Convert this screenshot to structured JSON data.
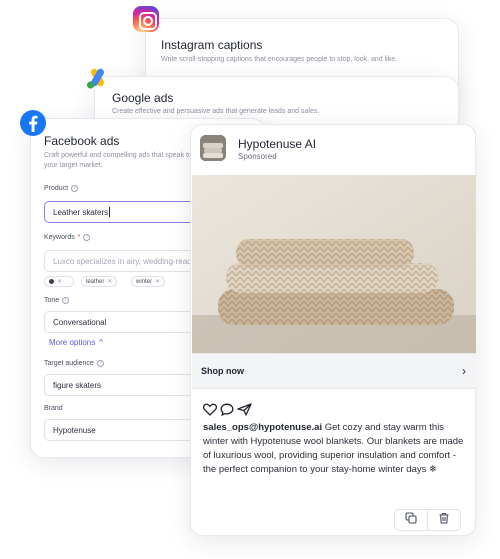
{
  "tools": {
    "instagram": {
      "title": "Instagram captions",
      "description": "Write scroll-stopping captions that encourages people to stop, look, and like."
    },
    "google": {
      "title": "Google ads",
      "description": "Create effective and persuasive ads that generate leads and sales."
    },
    "facebook": {
      "title": "Facebook ads",
      "description": "Craft powerful and compelling ads that speak to your target market."
    }
  },
  "form": {
    "product": {
      "label": "Product",
      "value": "Leather skaters"
    },
    "keywords": {
      "label": "Keywords",
      "required_mark": "*",
      "placeholder": "Luxco specializes in airy, wedding-ready",
      "chips": [
        "leather",
        "winter"
      ]
    },
    "tone": {
      "label": "Tone",
      "value": "Conversational"
    },
    "more_options": {
      "label": "More options",
      "chevron": "^"
    },
    "target_audience": {
      "label": "Target audience",
      "value": "figure skaters"
    },
    "brand": {
      "label": "Brand",
      "value": "Hypotenuse"
    }
  },
  "ad_preview": {
    "page_name": "Hypotenuse AI",
    "sponsored_label": "Sponsored",
    "cta_label": "Shop now",
    "chevron": "›",
    "handle": "sales_ops@hypotenuse.ai",
    "body": "Get cozy and stay warm this winter with Hypotenuse wool blankets. Our blankets are made of luxurious wool, providing superior insulation and comfort - the perfect companion to your stay-home winter days ❄"
  },
  "icons": {
    "instagram": "instagram-icon",
    "google": "google-ads-icon",
    "facebook": "facebook-icon",
    "heart": "heart-icon",
    "comment": "comment-icon",
    "share": "send-icon",
    "copy": "copy-icon",
    "delete": "trash-icon"
  },
  "colors": {
    "accent": "#5b5bd6",
    "facebook_blue": "#1877F2",
    "focus_border": "#8c7ae6"
  }
}
